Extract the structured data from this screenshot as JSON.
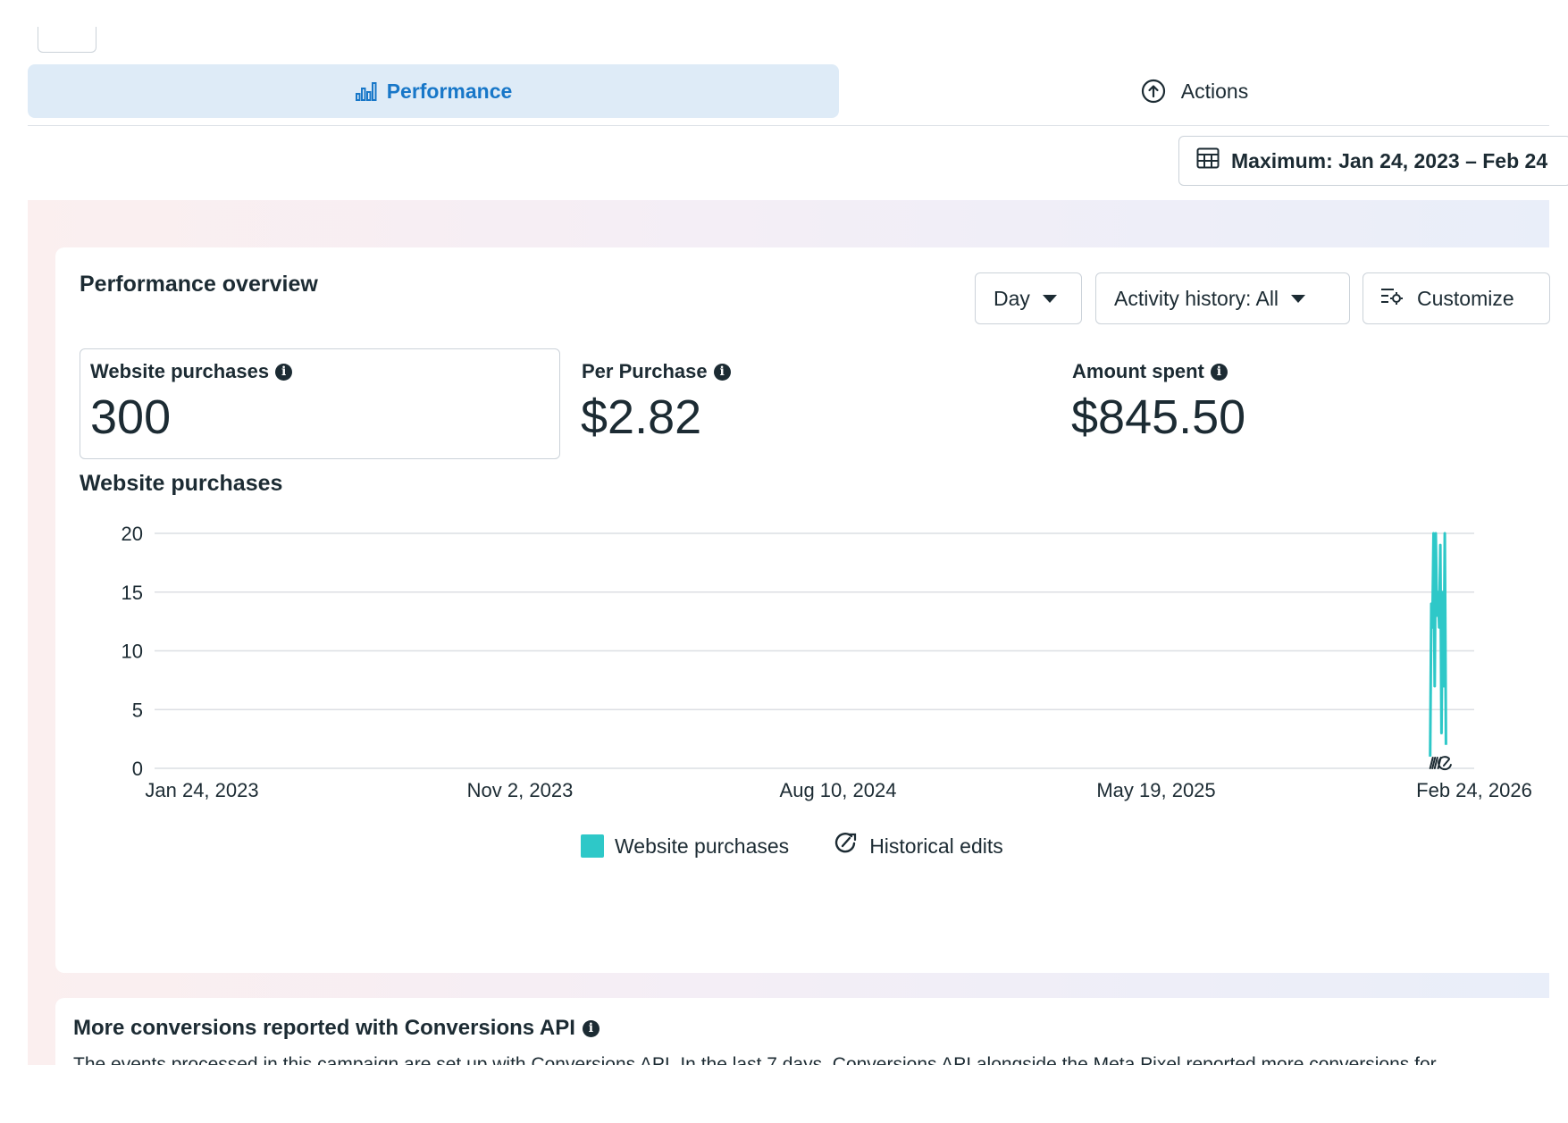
{
  "tabs": [
    {
      "label": "Performance",
      "icon": "bar-chart-icon",
      "active": true
    },
    {
      "label": "Actions",
      "icon": "upload-circle-icon",
      "active": false
    }
  ],
  "date_range": {
    "label": "Maximum: Jan 24, 2023 – Feb 24",
    "icon": "calendar-icon"
  },
  "overview": {
    "title": "Performance overview",
    "controls": {
      "granularity": "Day",
      "activity": "Activity history: All",
      "customize": "Customize"
    },
    "metrics": [
      {
        "label": "Website purchases",
        "value": "300"
      },
      {
        "label": "Per Purchase",
        "value": "$2.82"
      },
      {
        "label": "Amount spent",
        "value": "$845.50"
      }
    ],
    "chart_title": "Website purchases"
  },
  "chart_data": {
    "type": "line",
    "title": "Website purchases",
    "xlabel": "",
    "ylabel": "",
    "x_ticks": [
      "Jan 24, 2023",
      "Nov 2, 2023",
      "Aug 10, 2024",
      "May 19, 2025",
      "Feb 24, 2026"
    ],
    "y_ticks": [
      "20",
      "15",
      "10",
      "5",
      "0"
    ],
    "xlim": [
      "2023-01-24",
      "2026-02-24"
    ],
    "ylim": [
      0,
      20
    ],
    "grid": true,
    "legend_position": "bottom-center",
    "series": [
      {
        "name": "Website purchases",
        "color": "#2ec8c8",
        "points": [
          [
            "2026-01-16",
            1
          ],
          [
            "2026-01-17",
            14
          ],
          [
            "2026-01-18",
            12
          ],
          [
            "2026-01-19",
            20
          ],
          [
            "2026-01-20",
            7
          ],
          [
            "2026-01-21",
            20
          ],
          [
            "2026-01-22",
            13
          ],
          [
            "2026-01-23",
            15
          ],
          [
            "2026-01-24",
            12
          ],
          [
            "2026-01-25",
            19
          ],
          [
            "2026-01-26",
            3
          ],
          [
            "2026-01-27",
            15
          ],
          [
            "2026-01-28",
            7
          ],
          [
            "2026-01-29",
            20
          ],
          [
            "2026-01-30",
            2
          ]
        ]
      }
    ],
    "markers": {
      "name": "Historical edits",
      "icon": "historical-edits-icon",
      "dates": [
        "2026-01-16",
        "2026-01-18",
        "2026-01-20",
        "2026-01-23",
        "2026-01-28"
      ]
    },
    "legend": [
      "Website purchases",
      "Historical edits"
    ]
  },
  "conversions": {
    "title": "More conversions reported with Conversions API",
    "text": "The events processed in this campaign are set up with Conversions API. In the last 7 days, Conversions API alongside the Meta Pixel reported more conversions for"
  }
}
